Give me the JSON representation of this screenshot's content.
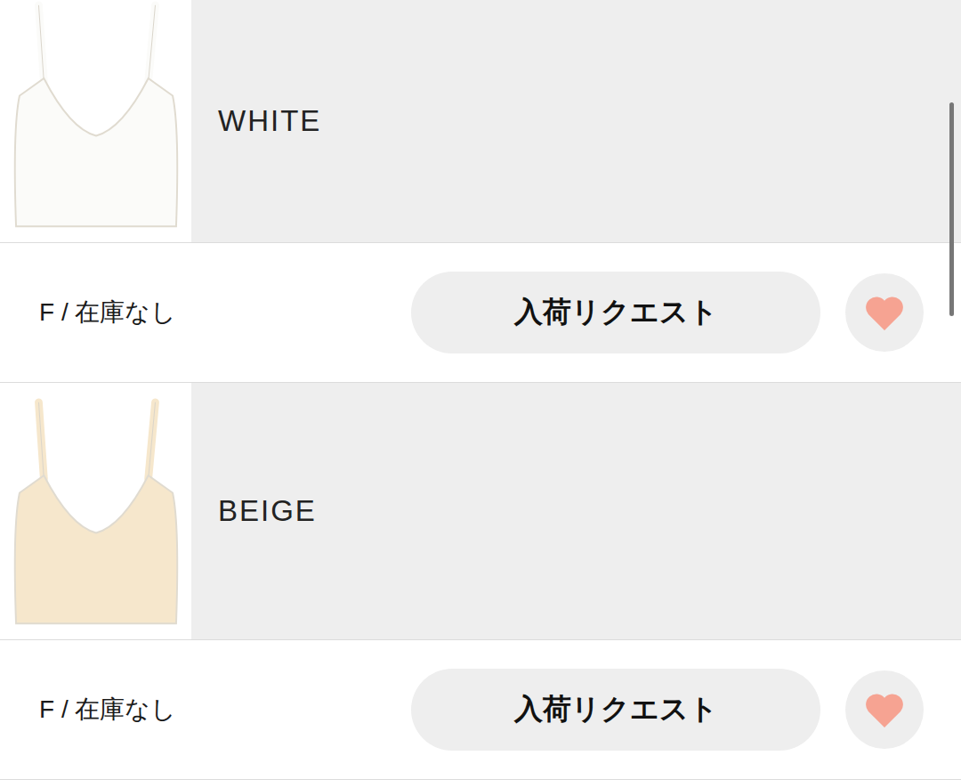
{
  "products": [
    {
      "color_name": "WHITE",
      "color": "#fbfbf9",
      "size_stock": "F / 在庫なし",
      "button": "入荷リクエスト"
    },
    {
      "color_name": "BEIGE",
      "color": "#f6e7cc",
      "size_stock": "F / 在庫なし",
      "button": "入荷リクエスト"
    }
  ]
}
